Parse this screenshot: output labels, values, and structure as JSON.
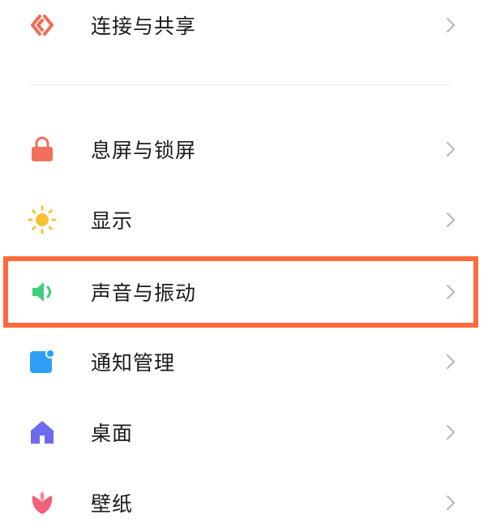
{
  "settings": {
    "items": [
      {
        "label": "连接与共享",
        "icon": "share-icon",
        "color": "#f06a52"
      },
      {
        "label": "息屏与锁屏",
        "icon": "lock-icon",
        "color": "#f2705b"
      },
      {
        "label": "显示",
        "icon": "sun-icon",
        "color": "#f7c232"
      },
      {
        "label": "声音与振动",
        "icon": "speaker-icon",
        "color": "#3ecf7b"
      },
      {
        "label": "通知管理",
        "icon": "notification-icon",
        "color": "#2da0f5"
      },
      {
        "label": "桌面",
        "icon": "home-icon",
        "color": "#6e6af0"
      },
      {
        "label": "壁纸",
        "icon": "tulip-icon",
        "color": "#f0607a"
      }
    ],
    "highlighted_item": "声音与振动",
    "highlight_color": "#ff6b3d"
  }
}
